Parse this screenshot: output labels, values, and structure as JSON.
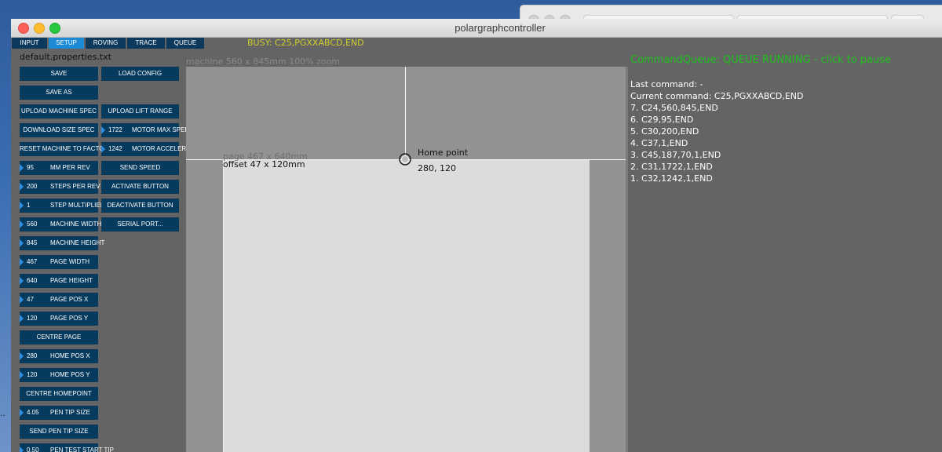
{
  "window": {
    "title": "polargraphcontroller"
  },
  "tabs": [
    {
      "label": "INPUT"
    },
    {
      "label": "SETUP"
    },
    {
      "label": "ROVING"
    },
    {
      "label": "TRACE"
    },
    {
      "label": "QUEUE"
    }
  ],
  "status": {
    "busy": "BUSY: C25,PGXXABCD,END"
  },
  "properties_file": "default.properties.txt",
  "buttons": {
    "save": "SAVE",
    "load_config": "LOAD CONFIG",
    "save_as": "SAVE AS",
    "upload_machine_spec": "UPLOAD MACHINE SPEC",
    "upload_lift_range": "UPLOAD LIFT RANGE",
    "download_size_spec": "DOWNLOAD SIZE SPEC",
    "reset_machine_to_factory": "RESET MACHINE TO FACTORY",
    "send_speed": "SEND SPEED",
    "activate_button": "ACTIVATE BUTTON",
    "deactivate_button": "DEACTIVATE BUTTON",
    "serial_port": "SERIAL PORT...",
    "centre_page": "CENTRE PAGE",
    "centre_homepoint": "CENTRE HOMEPOINT",
    "send_pen_tip_size": "SEND PEN TIP SIZE"
  },
  "numeric_fields": {
    "motor_max_speed": {
      "value": "1722",
      "label": "MOTOR MAX SPEED"
    },
    "motor_acceleration": {
      "value": "1242",
      "label": "MOTOR ACCELERATION"
    },
    "mm_per_rev": {
      "value": "95",
      "label": "MM PER REV"
    },
    "steps_per_rev": {
      "value": "200",
      "label": "STEPS PER REV"
    },
    "step_multiplier": {
      "value": "1",
      "label": "STEP MULTIPLIER"
    },
    "machine_width": {
      "value": "560",
      "label": "MACHINE WIDTH"
    },
    "machine_height": {
      "value": "845",
      "label": "MACHINE HEIGHT"
    },
    "page_width": {
      "value": "467",
      "label": "PAGE WIDTH"
    },
    "page_height": {
      "value": "640",
      "label": "PAGE HEIGHT"
    },
    "page_pos_x": {
      "value": "47",
      "label": "PAGE POS X"
    },
    "page_pos_y": {
      "value": "120",
      "label": "PAGE POS Y"
    },
    "home_pos_x": {
      "value": "280",
      "label": "HOME POS X"
    },
    "home_pos_y": {
      "value": "120",
      "label": "HOME POS Y"
    },
    "pen_tip_size": {
      "value": "4.05",
      "label": "PEN TIP SIZE"
    },
    "pen_test_start_tip": {
      "value": "0.50",
      "label": "PEN TEST START TIP"
    }
  },
  "canvas": {
    "machine_label": "machine 560 x 845mm 100% zoom",
    "page_label": "page 467 x 640mm",
    "offset_label": "offset 47 x 120mm",
    "home_label": "Home point",
    "home_coords": "280, 120"
  },
  "queue": {
    "status": "CommandQueue: QUEUE RUNNING - click to pause",
    "last_command": "Last command: -",
    "current_command": "Current command: C25,PGXXABCD,END",
    "items": [
      "7. C24,560,845,END",
      "6. C29,95,END",
      "5. C30,200,END",
      "4. C37,1,END",
      "3. C45,187,70,1,END",
      "2. C31,1722,1,END",
      "1. C32,1242,1,END"
    ]
  },
  "desktop": {
    "dots": ".."
  },
  "colors": {
    "button_bg": "#063b5e",
    "active_tab": "#1c8ad4",
    "busy_text": "#cfcf2a",
    "queue_running": "#1ec11e"
  }
}
